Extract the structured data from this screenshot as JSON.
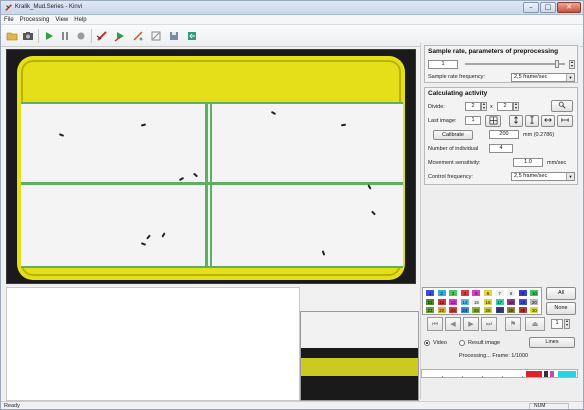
{
  "window": {
    "title": "Kralik_Mud.Series - Kinvi",
    "min_label": "–",
    "max_label": "□",
    "close_label": "✕"
  },
  "menu": [
    "File",
    "Processing",
    "View",
    "Help"
  ],
  "toolbar": {
    "icons": [
      "open-folder-icon",
      "camera-icon",
      "play-icon",
      "pause-icon",
      "record-icon",
      "pen-icon",
      "play-track-icon",
      "track-icon",
      "crop-icon",
      "save-icon",
      "export-icon"
    ]
  },
  "panel": {
    "sample_section": {
      "title": "Sample rate, parameters of preprocessing",
      "sample_value": "1",
      "rate_label": "Sample rate frequency:",
      "rate_value": "2,5 frame/sec",
      "slider_fraction": 0.92
    },
    "calc_section": {
      "title": "Calculating activity",
      "divide_label": "Divide:",
      "divide_x": "2",
      "divide_sep": "x",
      "divide_y": "2",
      "last_image_label": "Last image:",
      "last_image_value": "1",
      "calibrate_label": "Calibrate",
      "calibrate_value": "200",
      "calibrate_unit": "mm (0.2786)",
      "individuals_label": "Number of individual",
      "individuals_value": "4",
      "sensitivity_label": "Movement sensitivity:",
      "sensitivity_value": "1.0",
      "sensitivity_unit": "mm/sec",
      "control_label": "Control frequency:",
      "control_value": "2,5 frame/sec"
    }
  },
  "palette": {
    "rows": [
      [
        "1",
        "2",
        "3",
        "4",
        "5",
        "6",
        "7",
        "8",
        "9",
        "10"
      ],
      [
        "11",
        "12",
        "13",
        "14",
        "15",
        "16",
        "17",
        "18",
        "19",
        "20"
      ],
      [
        "21",
        "22",
        "23",
        "24",
        "25",
        "26",
        "27",
        "28",
        "29",
        "30"
      ]
    ],
    "colors": [
      [
        "#3b4fd8",
        "#2fb1d8",
        "#4ac95a",
        "#d83b3b",
        "#d83bc9",
        "#e0d33b",
        "#f0f0f0",
        "#f0f0f0",
        "#3b3bd8",
        "#3bc95a"
      ],
      [
        "#4a8a2c",
        "#c93b3b",
        "#d83bc9",
        "#5fb8e0",
        "#f0f0f0",
        "#e0d33b",
        "#3bc9b1",
        "#8a3b8a",
        "#3b4fd8",
        "#b8b8b8"
      ],
      [
        "#6a9a3b",
        "#d8b13b",
        "#d83b3b",
        "#3b8ad8",
        "#8ab13b",
        "#c9c93b",
        "#3b3b8a",
        "#8a8a3b",
        "#b83b3b",
        "#d8d83b"
      ]
    ],
    "all_label": "All",
    "none_label": "None",
    "spin_value": "1"
  },
  "mode": {
    "video_label": "Video",
    "result_label": "Result image",
    "lines_label": "Lines",
    "selected": "video"
  },
  "processing": {
    "status": "Processing... Frame: 1/1000"
  },
  "status": {
    "left": "Ready",
    "right": "NUM"
  }
}
